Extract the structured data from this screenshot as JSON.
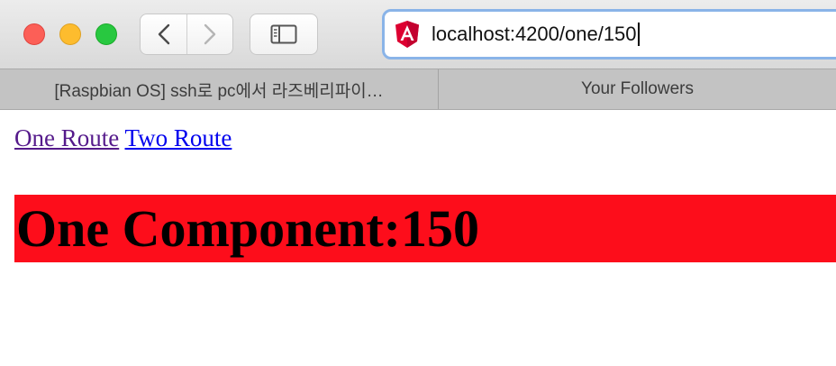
{
  "window": {
    "address_bar": {
      "url": "localhost:4200/one/150",
      "site_icon": "angular-icon"
    }
  },
  "tabs": [
    {
      "label": "[Raspbian OS] ssh로 pc에서 라즈베리파이…"
    },
    {
      "label": "Your Followers"
    }
  ],
  "page": {
    "links": [
      {
        "label": "One Route",
        "visited": true
      },
      {
        "label": "Two Route",
        "visited": false
      }
    ],
    "heading": "One Component:150"
  },
  "colors": {
    "heading_background": "#fd0d1b",
    "link_visited": "#551a8b",
    "link_unvisited": "#0000ee",
    "address_focus_ring": "#8ab4e8"
  }
}
